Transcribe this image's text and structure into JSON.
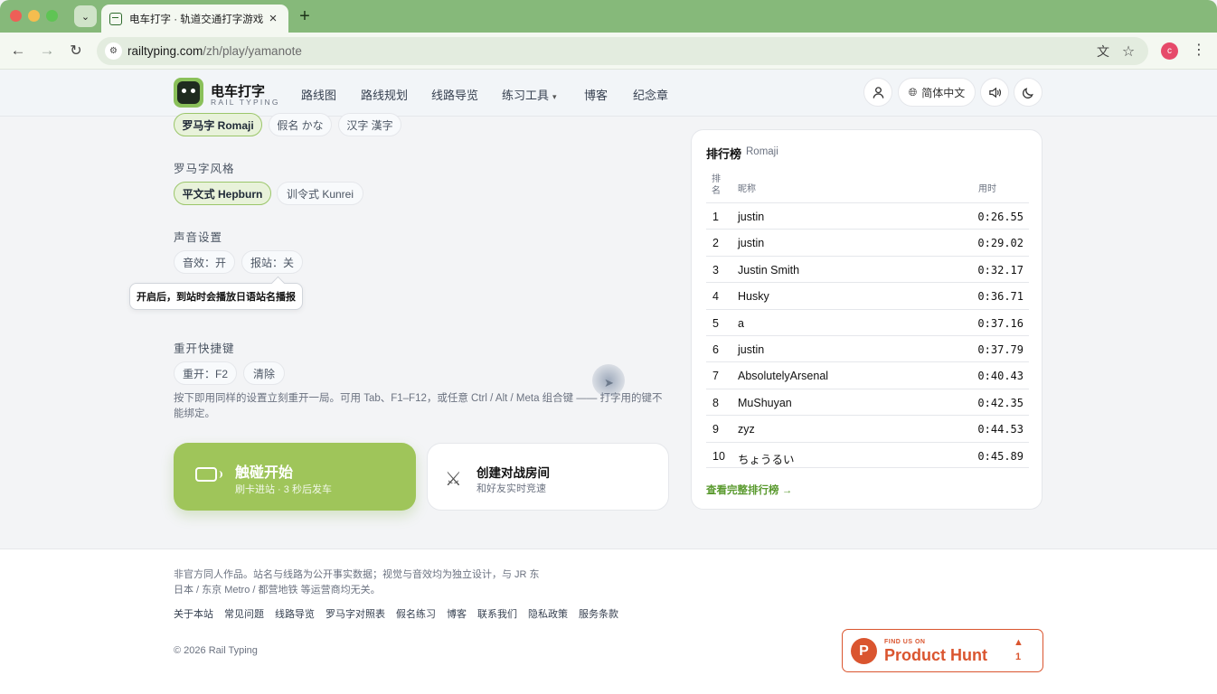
{
  "browser": {
    "tab_title": "电车打字 · 轨道交通打字游戏",
    "url_host": "railtyping.com",
    "url_path": "/zh/play/yamanote",
    "profile_initial": "c"
  },
  "header": {
    "logo_title": "电车打字",
    "logo_sub": "RAIL TYPING",
    "nav": {
      "routes": "路线图",
      "plan": "路线规划",
      "guide": "线路导览",
      "tools": "练习工具",
      "blog": "博客",
      "medal": "纪念章"
    },
    "language": "简体中文"
  },
  "settings": {
    "input_mode": {
      "romaji": "罗马字 Romaji",
      "kana": "假名 かな",
      "kanji": "汉字 漢字"
    },
    "romaji_style": {
      "label": "罗马字风格",
      "hepburn": "平文式 Hepburn",
      "kunrei": "训令式 Kunrei"
    },
    "sound": {
      "label": "声音设置",
      "sfx": "音效：开",
      "announce": "报站：关",
      "tooltip": "开启后，到站时会播放日语站名播报"
    },
    "restart": {
      "label": "重开快捷键",
      "key": "重开：F2",
      "clear": "清除",
      "hint": "按下即用同样的设置立刻重开一局。可用 Tab、F1–F12，或任意 Ctrl / Alt / Meta 组合键 —— 打字用的键不能绑定。"
    }
  },
  "actions": {
    "start_title": "触碰开始",
    "start_sub": "刷卡进站 · 3 秒后发车",
    "battle_title": "创建对战房间",
    "battle_sub": "和好友实时竞速"
  },
  "leaderboard": {
    "title": "排行榜",
    "mode": "Romaji",
    "col_rank": "排名",
    "col_name": "昵称",
    "col_time": "用时",
    "rows": [
      {
        "rank": "1",
        "name": "justin",
        "time": "0:26.55"
      },
      {
        "rank": "2",
        "name": "justin",
        "time": "0:29.02"
      },
      {
        "rank": "3",
        "name": "Justin Smith",
        "time": "0:32.17"
      },
      {
        "rank": "4",
        "name": "Husky",
        "time": "0:36.71"
      },
      {
        "rank": "5",
        "name": "a",
        "time": "0:37.16"
      },
      {
        "rank": "6",
        "name": "justin",
        "time": "0:37.79"
      },
      {
        "rank": "7",
        "name": "AbsolutelyArsenal",
        "time": "0:40.43"
      },
      {
        "rank": "8",
        "name": "MuShuyan",
        "time": "0:42.35"
      },
      {
        "rank": "9",
        "name": "zyz",
        "time": "0:44.53"
      },
      {
        "rank": "10",
        "name": "ちょうるい",
        "time": "0:45.89"
      }
    ],
    "full_link": "查看完整排行榜 →"
  },
  "footer": {
    "note": "非官方同人作品。站名与线路为公开事实数据；视觉与音效均为独立设计，与 JR 东日本 / 东京 Metro / 都营地铁 等运营商均无关。",
    "links": [
      "关于本站",
      "常见问题",
      "线路导览",
      "罗马字对照表",
      "假名练习",
      "博客",
      "联系我们",
      "隐私政策",
      "服务条款"
    ],
    "copyright": "© 2026 Rail Typing",
    "ph_small": "FIND US ON",
    "ph_big": "Product Hunt",
    "ph_count": "1"
  },
  "colors": {
    "accent": "#9fc55a",
    "link": "#5a9a2f",
    "product_hunt": "#da552f",
    "tabbar": "#86b97a"
  }
}
